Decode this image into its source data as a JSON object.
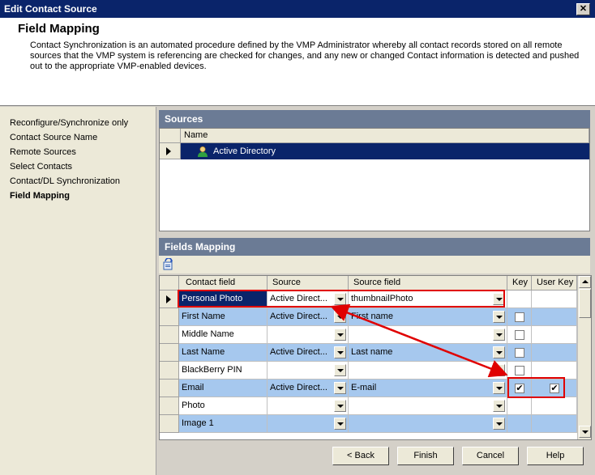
{
  "window": {
    "title": "Edit Contact Source",
    "close_label": "✕"
  },
  "header": {
    "title": "Field Mapping",
    "description": "Contact Synchronization is an automated procedure defined by the VMP Administrator whereby all contact records stored on all remote sources that the VMP system is referencing are checked for changes, and any new or changed Contact information is detected and pushed out to the appropriate VMP-enabled devices."
  },
  "sidebar": {
    "items": [
      {
        "label": "Reconfigure/Synchronize only"
      },
      {
        "label": "Contact Source Name"
      },
      {
        "label": "Remote Sources"
      },
      {
        "label": "Select Contacts"
      },
      {
        "label": "Contact/DL Synchronization"
      },
      {
        "label": "Field Mapping"
      }
    ]
  },
  "sources": {
    "header": "Sources",
    "column_name": "Name",
    "rows": [
      {
        "name": "Active Directory"
      }
    ]
  },
  "fields_mapping": {
    "header": "Fields Mapping",
    "columns": {
      "contact_field": "Contact field",
      "source": "Source",
      "source_field": "Source field",
      "key": "Key",
      "user_key": "User Key"
    },
    "rows": [
      {
        "contact_field": "Personal Photo",
        "source": "Active Direct...",
        "source_field": "thumbnailPhoto",
        "key": null,
        "user_key": null
      },
      {
        "contact_field": "First Name",
        "source": "Active Direct...",
        "source_field": "First name",
        "key": "",
        "user_key": null
      },
      {
        "contact_field": "Middle Name",
        "source": "",
        "source_field": "",
        "key": "",
        "user_key": null
      },
      {
        "contact_field": "Last Name",
        "source": "Active Direct...",
        "source_field": "Last name",
        "key": "",
        "user_key": null
      },
      {
        "contact_field": "BlackBerry PIN",
        "source": "",
        "source_field": "",
        "key": "",
        "user_key": null
      },
      {
        "contact_field": "Email",
        "source": "Active Direct...",
        "source_field": "E-mail",
        "key": "✔",
        "user_key": "✔"
      },
      {
        "contact_field": "Photo",
        "source": "",
        "source_field": "",
        "key": null,
        "user_key": null
      },
      {
        "contact_field": "Image 1",
        "source": "",
        "source_field": "",
        "key": null,
        "user_key": null
      }
    ]
  },
  "buttons": {
    "back": "< Back",
    "finish": "Finish",
    "cancel": "Cancel",
    "help": "Help"
  },
  "colors": {
    "title_bar": "#0a246a",
    "selection": "#0a246a",
    "alt_row": "#a6c8ee",
    "panel_header": "#6b7b95",
    "annotation": "#e00000"
  }
}
